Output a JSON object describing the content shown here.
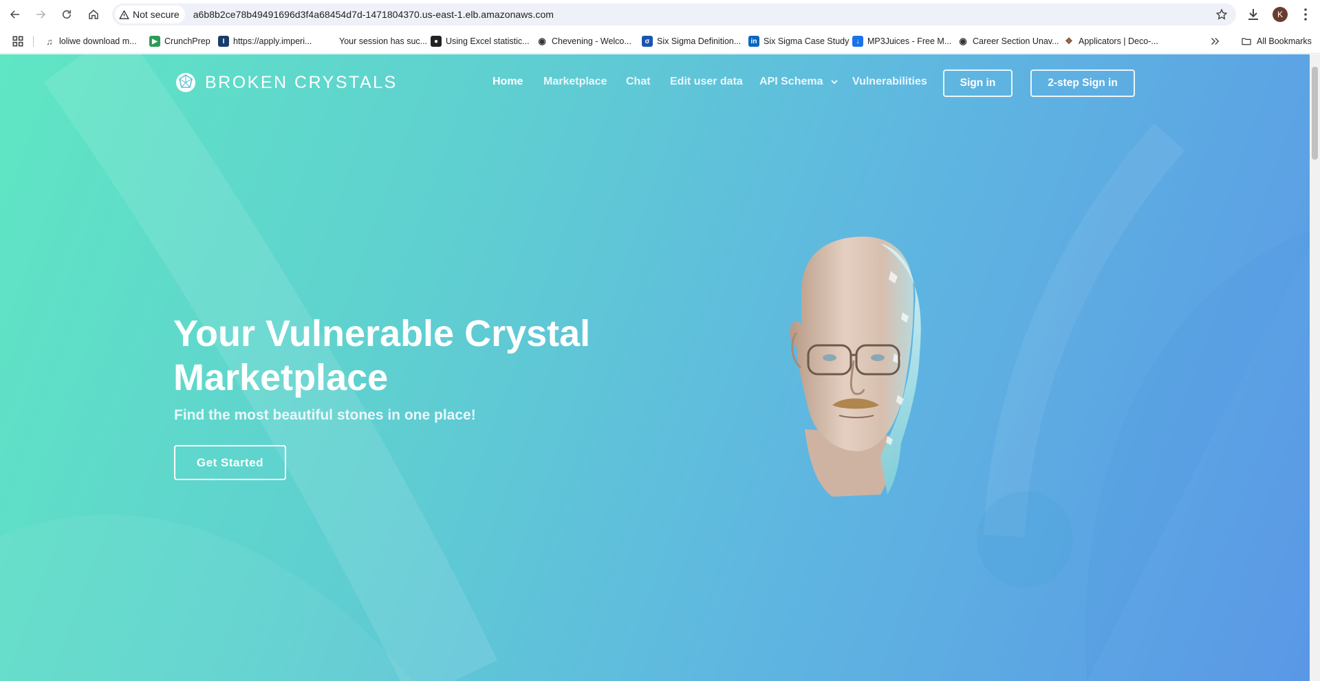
{
  "browser": {
    "security_label": "Not secure",
    "url": "a6b8b2ce78b49491696d3f4a68454d7d-1471804370.us-east-1.elb.amazonaws.com",
    "profile_initial": "K",
    "bookmarks": [
      {
        "label": "loliwe download m...",
        "icon": "music-note-icon",
        "color": "#555555"
      },
      {
        "label": "CrunchPrep",
        "icon": "crunchprep-icon",
        "color": "#2e9b54"
      },
      {
        "label": "https://apply.imperi...",
        "icon": "imperial-icon",
        "color": "#1b3d6d"
      },
      {
        "label": "Your session has suc...",
        "icon": "blank-page-icon",
        "color": "#ffffff"
      },
      {
        "label": "Using Excel statistic...",
        "icon": "excel-stat-icon",
        "color": "#222222"
      },
      {
        "label": "Chevening - Welco...",
        "icon": "globe-icon",
        "color": "#333333"
      },
      {
        "label": "Six Sigma Definition...",
        "icon": "sixsigma-icon",
        "color": "#1a56b0"
      },
      {
        "label": "Six Sigma Case Study",
        "icon": "linkedin-icon",
        "color": "#0a66c2"
      },
      {
        "label": "MP3Juices - Free M...",
        "icon": "download-icon",
        "color": "#1a73e8"
      },
      {
        "label": "Career Section Unav...",
        "icon": "globe-icon",
        "color": "#333333"
      },
      {
        "label": "Applicators | Deco-...",
        "icon": "applicators-icon",
        "color": "#8a5a3c"
      }
    ],
    "all_bookmarks_label": "All Bookmarks"
  },
  "site": {
    "brand": "BROKEN CRYSTALS",
    "nav": {
      "home": "Home",
      "marketplace": "Marketplace",
      "chat": "Chat",
      "edit_user_data": "Edit user data",
      "api_schema": "API Schema",
      "vulnerabilities": "Vulnerabilities"
    },
    "sign_in": "Sign in",
    "two_step_sign_in": "2-step Sign in"
  },
  "hero": {
    "title_line1": "Your Vulnerable Crystal",
    "title_line2": "Marketplace",
    "subtitle": "Find the most beautiful stones in one place!",
    "cta": "Get Started"
  },
  "colors": {
    "gradient_start": "#5fe6c3",
    "gradient_end": "#5a97e6",
    "accent_text": "#ffffff"
  }
}
